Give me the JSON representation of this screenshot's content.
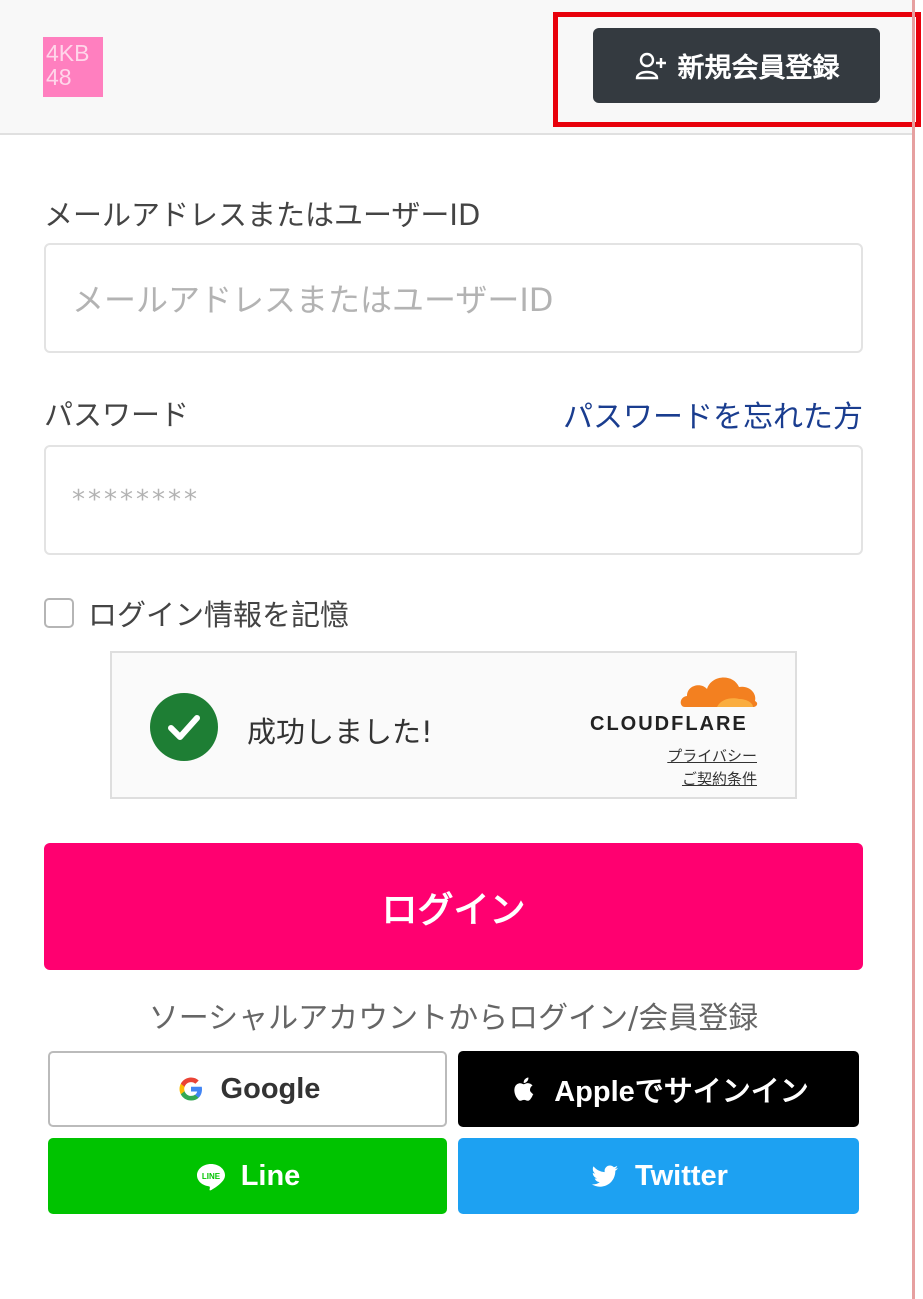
{
  "header": {
    "logo_line1": "4KB",
    "logo_line2": "48",
    "register_label": "新規会員登録"
  },
  "form": {
    "email_label": "メールアドレスまたはユーザーID",
    "email_placeholder": "メールアドレスまたはユーザーID",
    "password_label": "パスワード",
    "forgot_label": "パスワードを忘れた方",
    "password_placeholder": "********",
    "remember_label": "ログイン情報を記憶"
  },
  "captcha": {
    "status": "成功しました!",
    "brand": "CLOUDFLARE",
    "privacy_label": "プライバシー",
    "terms_label": "ご契約条件"
  },
  "login": {
    "button_label": "ログイン",
    "social_caption": "ソーシャルアカウントからログイン/会員登録"
  },
  "social": {
    "google": "Google",
    "apple": "Appleでサインイン",
    "line": "Line",
    "twitter": "Twitter"
  },
  "colors": {
    "login_pink": "#ff0070",
    "register_dark": "#343a40",
    "highlight_red": "#e8000b",
    "line_green": "#00c300",
    "twitter_blue": "#1da1f2",
    "success_green": "#1e7e34",
    "cloudflare_orange": "#f38020"
  }
}
